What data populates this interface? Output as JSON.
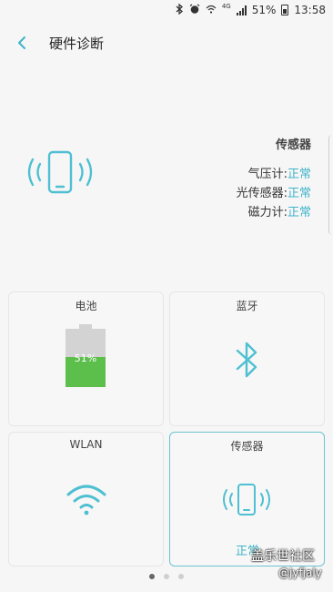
{
  "statusbar": {
    "network": "4G",
    "battery": "51%",
    "time": "13:58"
  },
  "header": {
    "title": "硬件诊断"
  },
  "hero": {
    "title": "传感器",
    "rows": [
      {
        "label": "气压计:",
        "status": "正常"
      },
      {
        "label": "光传感器:",
        "status": "正常"
      },
      {
        "label": "磁力计:",
        "status": "正常"
      }
    ]
  },
  "cards": {
    "battery": {
      "label": "电池",
      "percent_text": "51%",
      "level": 0.51
    },
    "bluetooth": {
      "label": "蓝牙"
    },
    "wlan": {
      "label": "WLAN"
    },
    "sensor": {
      "label": "传感器",
      "status": "正常"
    }
  },
  "pager": {
    "count": 3,
    "active": 0
  },
  "watermark": {
    "line1": "盖乐世社区",
    "line2": "@jyfjaly"
  },
  "colors": {
    "accent": "#3fb4c9",
    "battery_green": "#5cbf4c"
  }
}
